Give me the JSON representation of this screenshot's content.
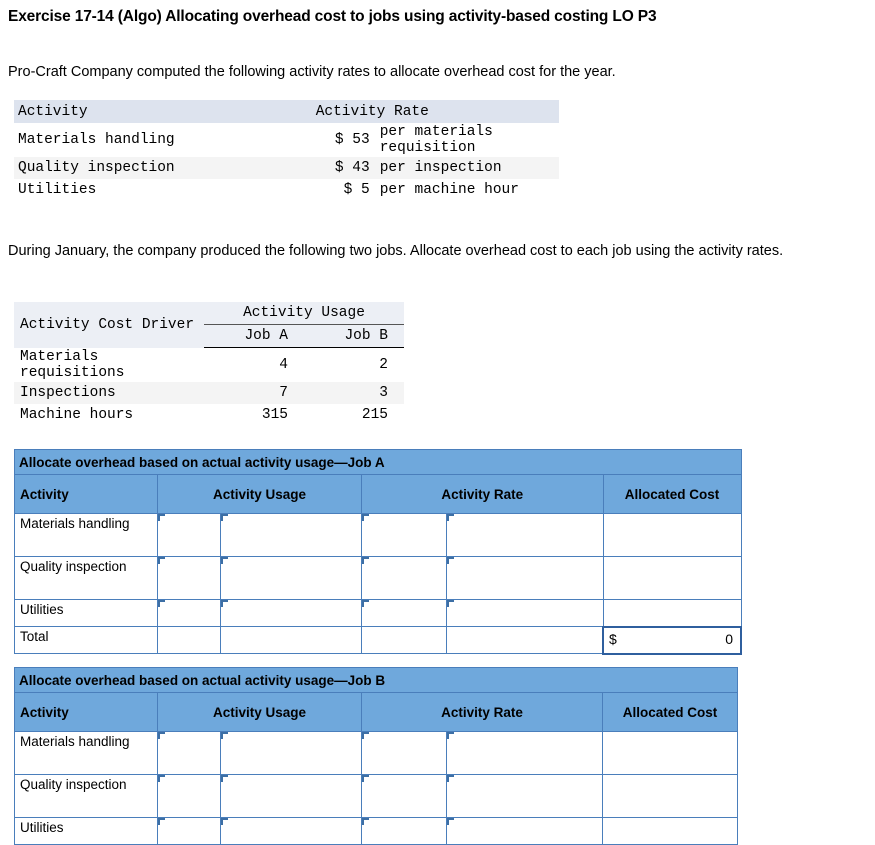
{
  "document": {
    "title": "Exercise 17-14 (Algo) Allocating overhead cost to jobs using activity-based costing LO P3",
    "intro_paragraph": "Pro-Craft Company computed the following activity rates to allocate overhead cost for the year.",
    "second_paragraph": "During January, the company produced the following two jobs. Allocate overhead cost to each job using the activity rates."
  },
  "rates_table": {
    "headers": [
      "Activity",
      "Activity Rate"
    ],
    "rows": [
      {
        "activity": "Materials handling",
        "amount": "$ 53",
        "per": "per materials requisition"
      },
      {
        "activity": "Quality inspection",
        "amount": "$ 43",
        "per": "per inspection"
      },
      {
        "activity": "Utilities",
        "amount": "$ 5",
        "per": "per machine hour"
      }
    ]
  },
  "usage_table": {
    "header_driver": "Activity Cost Driver",
    "header_usage": "Activity Usage",
    "header_job_a": "Job A",
    "header_job_b": "Job B",
    "rows": [
      {
        "driver": "Materials requisitions",
        "job_a": "4",
        "job_b": "2"
      },
      {
        "driver": "Inspections",
        "job_a": "7",
        "job_b": "3"
      },
      {
        "driver": "Machine hours",
        "job_a": "315",
        "job_b": "215"
      }
    ]
  },
  "job_a_grid": {
    "band_title": "Allocate overhead based on actual activity usage—Job A",
    "columns": [
      "Activity",
      "Activity Usage",
      "Activity Rate",
      "Allocated Cost"
    ],
    "rows": [
      {
        "label": "Materials handling"
      },
      {
        "label": "Quality inspection"
      },
      {
        "label": "Utilities"
      }
    ],
    "total_label": "Total",
    "total_currency": "$",
    "total_value": "0"
  },
  "job_b_grid": {
    "band_title": "Allocate overhead based on actual activity usage—Job B",
    "columns": [
      "Activity",
      "Activity Usage",
      "Activity Rate",
      "Allocated Cost"
    ],
    "rows": [
      {
        "label": "Materials handling"
      },
      {
        "label": "Quality inspection"
      },
      {
        "label": "Utilities"
      }
    ]
  },
  "colors": {
    "band_blue": "#6fa8dc",
    "grid_border": "#4a7ebb",
    "table_header_gray": "#dde3ee",
    "row_alt_gray": "#f4f4f4"
  }
}
